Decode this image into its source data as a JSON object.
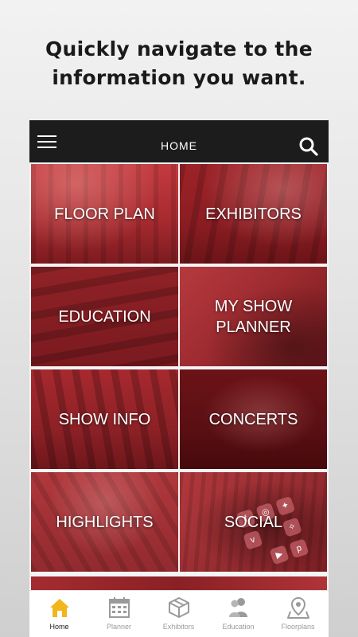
{
  "headline": {
    "line1": "Quickly navigate to the",
    "line2": "information you want."
  },
  "topbar": {
    "title": "HOME",
    "menu_icon": "hamburger-menu-icon",
    "search_icon": "search-icon"
  },
  "tiles": [
    {
      "label": "FLOOR PLAN"
    },
    {
      "label": "EXHIBITORS"
    },
    {
      "label": "EDUCATION"
    },
    {
      "label": "MY SHOW\nPLANNER"
    },
    {
      "label": "SHOW INFO"
    },
    {
      "label": "CONCERTS"
    },
    {
      "label": "HIGHLIGHTS"
    },
    {
      "label": "SOCIAL"
    }
  ],
  "tabs": [
    {
      "label": "Home",
      "icon": "home-icon",
      "active": true
    },
    {
      "label": "Planner",
      "icon": "calendar-icon",
      "active": false
    },
    {
      "label": "Exhibitors",
      "icon": "box-icon",
      "active": false
    },
    {
      "label": "Education",
      "icon": "people-icon",
      "active": false
    },
    {
      "label": "Floorplans",
      "icon": "map-pin-icon",
      "active": false
    }
  ],
  "colors": {
    "accent_active_tab": "#f2b51c",
    "topbar_bg": "#1c1c1c",
    "tile_red": "#8e1f24",
    "tab_inactive": "#9a9a9a"
  }
}
